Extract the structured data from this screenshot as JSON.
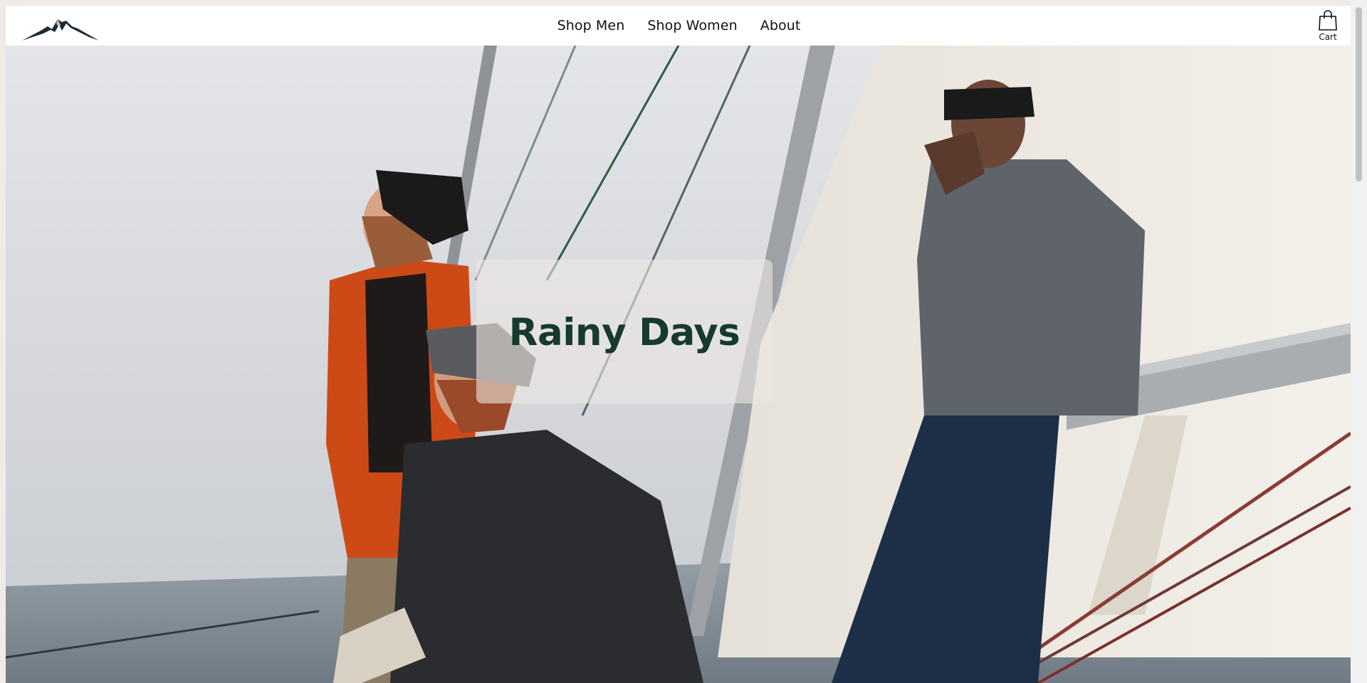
{
  "brand": {
    "logo_icon": "mountain-logo-icon"
  },
  "nav": {
    "links": [
      {
        "label": "Shop Men"
      },
      {
        "label": "Shop Women"
      },
      {
        "label": "About"
      }
    ],
    "cart_label": "Cart",
    "cart_icon": "shopping-bag-icon"
  },
  "hero": {
    "title": "Rainy Days",
    "image": "sailboat-crew-photo"
  },
  "colors": {
    "title_green": "#163a2b",
    "navy_logo": "#1c2b33",
    "sky": "#d8d9dc"
  }
}
